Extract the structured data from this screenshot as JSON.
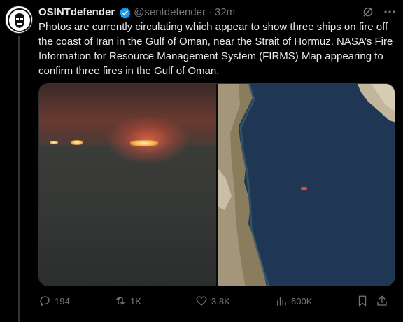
{
  "author": {
    "display_name": "OSINTdefender",
    "handle": "@sentdefender",
    "separator": "·",
    "time": "32m"
  },
  "tweet": {
    "text": "Photos are currently circulating which appear to show three ships on fire off the coast of Iran in the Gulf of Oman, near the Strait of Hormuz. NASA’s Fire Information for Resource Management System (FIRMS) Map appearing to confirm three fires in the Gulf of Oman."
  },
  "metrics": {
    "replies": "194",
    "reposts": "1K",
    "likes": "3.8K",
    "views": "600K"
  },
  "icons": {
    "verified": "verified-badge-icon",
    "grok": "grok-icon",
    "more": "more-icon",
    "reply": "reply-icon",
    "repost": "repost-icon",
    "like": "heart-icon",
    "views": "views-icon",
    "bookmark": "bookmark-icon",
    "share": "share-icon"
  },
  "colors": {
    "background": "#000000",
    "text": "#e7e9ea",
    "muted": "#71767b",
    "verified": "#1d9bf0",
    "fire_marker": "#e8493c"
  }
}
